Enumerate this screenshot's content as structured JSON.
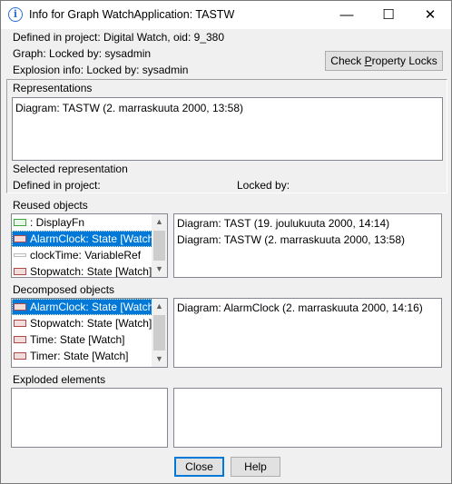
{
  "window": {
    "title": "Info for Graph WatchApplication: TASTW",
    "minimize": "—",
    "maximize": "☐",
    "close": "✕"
  },
  "info": {
    "defined_in_project": "Defined in project: Digital Watch, oid: 9_380",
    "graph_locked": "Graph: Locked by: sysadmin",
    "explosion_info": "Explosion info: Locked by: sysadmin",
    "check_locks_pre": "Check ",
    "check_locks_mnemonic": "P",
    "check_locks_post": "roperty Locks"
  },
  "representations": {
    "heading": "Representations",
    "items": [
      "Diagram: TASTW (2. marraskuuta 2000, 13:58)"
    ],
    "selected_heading": "Selected representation",
    "defined_in_project": "Defined in project:",
    "locked_by": "Locked by:"
  },
  "reused": {
    "heading": "Reused objects",
    "items": [
      {
        "label": ": DisplayFn",
        "icon": "green-rect-icon"
      },
      {
        "label": "AlarmClock: State [Watch]",
        "icon": "red-rect-icon",
        "selected": true
      },
      {
        "label": "clockTime: VariableRef",
        "icon": "gray-line-icon"
      },
      {
        "label": "Stopwatch: State [Watch]",
        "icon": "red-rect-icon"
      }
    ],
    "diagrams": [
      "Diagram: TAST (19. joulukuuta 2000, 14:14)",
      "Diagram: TASTW (2. marraskuuta 2000, 13:58)"
    ]
  },
  "decomposed": {
    "heading": "Decomposed objects",
    "items": [
      {
        "label": "AlarmClock: State [Watch]",
        "icon": "red-rect-icon",
        "selected": true
      },
      {
        "label": "Stopwatch: State [Watch]",
        "icon": "red-rect-icon"
      },
      {
        "label": "Time: State [Watch]",
        "icon": "red-rect-icon"
      },
      {
        "label": "Timer: State [Watch]",
        "icon": "red-rect-icon"
      }
    ],
    "diagrams": [
      "Diagram: AlarmClock (2. marraskuuta 2000, 14:16)"
    ]
  },
  "exploded": {
    "heading": "Exploded elements"
  },
  "buttons": {
    "close": "Close",
    "help": "Help"
  },
  "colors": {
    "selection": "#0078d7",
    "window_bg": "#f0f0f0",
    "info_icon": "#2a6fd6"
  }
}
